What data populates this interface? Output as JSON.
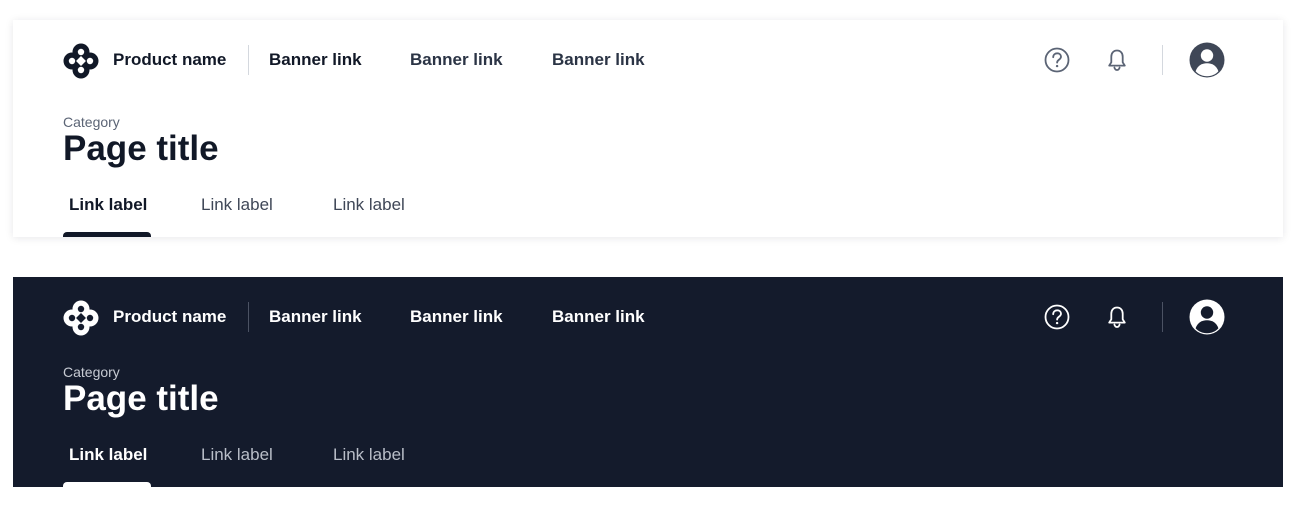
{
  "light_header": {
    "product_name": "Product name",
    "banner_links": [
      "Banner link",
      "Banner link",
      "Banner link"
    ],
    "category": "Category",
    "page_title": "Page title",
    "tabs": [
      {
        "label": "Link label",
        "active": true
      },
      {
        "label": "Link label",
        "active": false
      },
      {
        "label": "Link label",
        "active": false
      }
    ],
    "icons": [
      "help-icon",
      "bell-icon",
      "avatar"
    ]
  },
  "dark_header": {
    "product_name": "Product name",
    "banner_links": [
      "Banner link",
      "Banner link",
      "Banner link"
    ],
    "category": "Category",
    "page_title": "Page title",
    "tabs": [
      {
        "label": "Link label",
        "active": true
      },
      {
        "label": "Link label",
        "active": false
      },
      {
        "label": "Link label",
        "active": false
      }
    ],
    "icons": [
      "help-icon",
      "bell-icon",
      "avatar"
    ]
  },
  "colors": {
    "dark_background": "#141b2c",
    "light_text": "#111827",
    "muted_text": "#5b6475"
  }
}
